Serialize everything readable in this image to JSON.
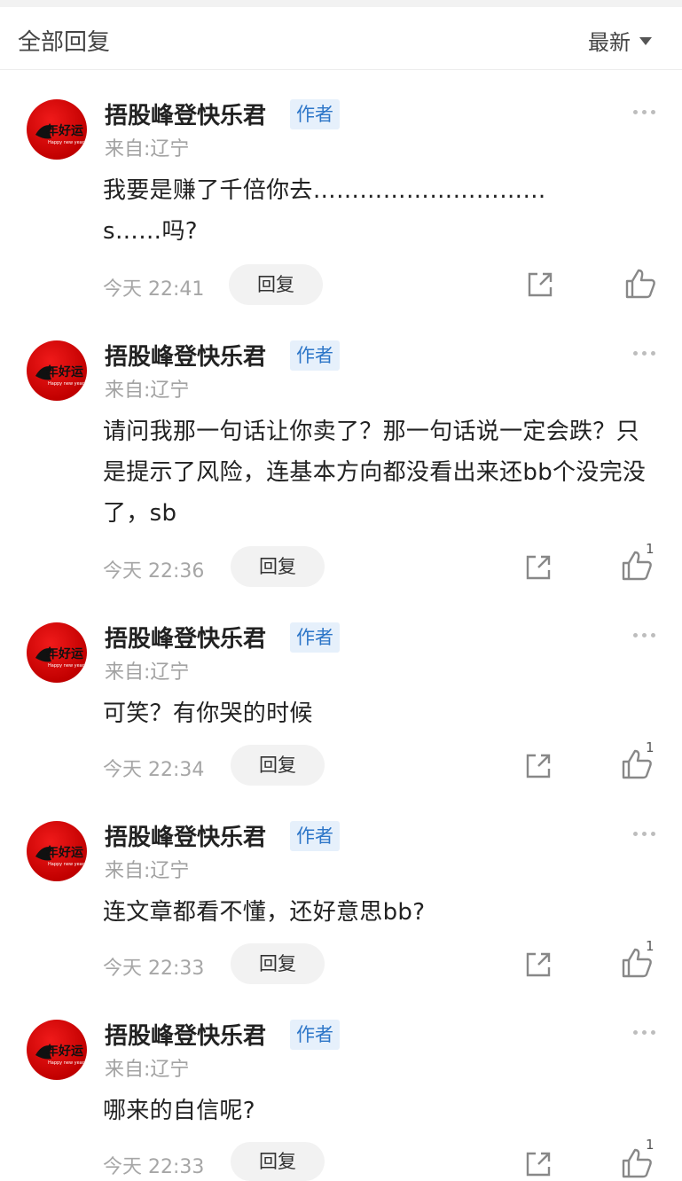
{
  "header": {
    "title": "全部回复",
    "sort_label": "最新"
  },
  "colors": {
    "badge_bg": "#e6f0fb",
    "badge_text": "#2d76c8",
    "avatar_red": "#d40000"
  },
  "comments": [
    {
      "author": "捂股峰登快乐君",
      "badge": "作者",
      "location": "来自:辽宁",
      "text": "我要是赚了千倍你去…………………………s……吗?",
      "time": "今天 22:41",
      "reply_label": "回复",
      "likes": ""
    },
    {
      "author": "捂股峰登快乐君",
      "badge": "作者",
      "location": "来自:辽宁",
      "text": "请问我那一句话让你卖了？那一句话说一定会跌？只是提示了风险，连基本方向都没看出来还bb个没完没了，sb",
      "time": "今天 22:36",
      "reply_label": "回复",
      "likes": "1"
    },
    {
      "author": "捂股峰登快乐君",
      "badge": "作者",
      "location": "来自:辽宁",
      "text": "可笑？有你哭的时候",
      "time": "今天 22:34",
      "reply_label": "回复",
      "likes": "1"
    },
    {
      "author": "捂股峰登快乐君",
      "badge": "作者",
      "location": "来自:辽宁",
      "text": "连文章都看不懂，还好意思bb?",
      "time": "今天 22:33",
      "reply_label": "回复",
      "likes": "1"
    },
    {
      "author": "捂股峰登快乐君",
      "badge": "作者",
      "location": "来自:辽宁",
      "text": "哪来的自信呢?",
      "time": "今天 22:33",
      "reply_label": "回复",
      "likes": "1"
    }
  ]
}
